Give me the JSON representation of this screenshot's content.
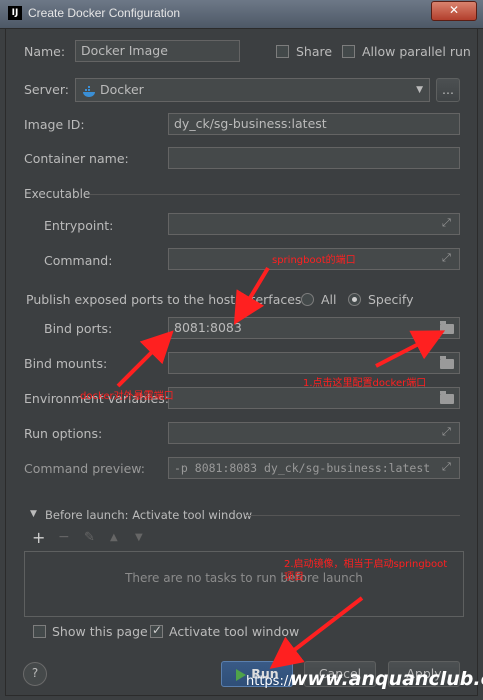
{
  "window": {
    "title": "Create Docker Configuration",
    "close_symbol": "✕",
    "app_icon_text": "IJ"
  },
  "name": {
    "label": "Name:",
    "value": "Docker Image"
  },
  "share": {
    "label": "Share",
    "checked": false
  },
  "parallel": {
    "label": "Allow parallel run",
    "checked": false
  },
  "server": {
    "label": "Server:",
    "value": "Docker",
    "more": "..."
  },
  "image_id": {
    "label": "Image ID:",
    "value": "dy_ck/sg-business:latest"
  },
  "container_name": {
    "label": "Container name:",
    "value": ""
  },
  "executable": {
    "section": "Executable",
    "entrypoint": {
      "label": "Entrypoint:",
      "value": ""
    },
    "command": {
      "label": "Command:",
      "value": ""
    }
  },
  "publish": {
    "label": "Publish exposed ports to the host interfaces:",
    "all": "All",
    "specify": "Specify",
    "selected": "Specify"
  },
  "bind_ports": {
    "label": "Bind ports:",
    "value": "8081:8083"
  },
  "bind_mounts": {
    "label": "Bind mounts:",
    "value": ""
  },
  "env_vars": {
    "label": "Environment variables:",
    "value": ""
  },
  "run_options": {
    "label": "Run options:",
    "value": ""
  },
  "command_preview": {
    "label": "Command preview:",
    "value": "-p 8081:8083 dy_ck/sg-business:latest"
  },
  "before_launch": {
    "title": "Before launch: Activate tool window",
    "toolbar": {
      "add": "+",
      "remove": "−",
      "edit": "✎",
      "up": "▲",
      "down": "▼"
    },
    "empty_text": "There are no tasks to run before launch"
  },
  "show_page": {
    "label": "Show this page",
    "checked": false
  },
  "activate_tool": {
    "label": "Activate tool window",
    "checked": true
  },
  "buttons": {
    "help": "?",
    "run": "Run",
    "cancel": "Cancel",
    "apply": "Apply"
  },
  "annotations": {
    "springboot_port": "springboot的端口",
    "docker_exposed": "docker对外暴露端口",
    "click_here": "1.点击这里配置docker端口",
    "start_image": "2.启动镜像，相当于启动springboot",
    "start_image_2": "项目"
  },
  "watermark": {
    "text": "www.anquanclub.cn",
    "sub": "https://"
  },
  "colors": {
    "background": "#3c3f41",
    "field": "#45494a",
    "annotation": "#ff2020",
    "run_icon": "#4fa34a"
  }
}
